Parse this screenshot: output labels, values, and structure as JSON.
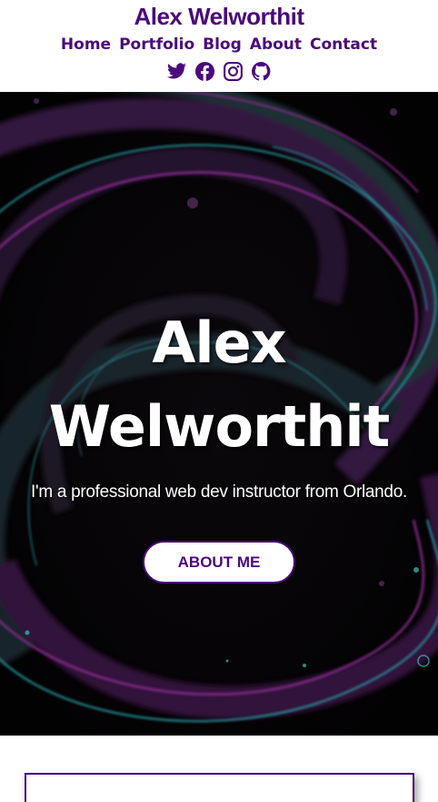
{
  "header": {
    "site_title": "Alex Welworthit",
    "nav": [
      {
        "label": "Home"
      },
      {
        "label": "Portfolio"
      },
      {
        "label": "Blog"
      },
      {
        "label": "About"
      },
      {
        "label": "Contact"
      }
    ],
    "social": [
      {
        "icon": "twitter-icon"
      },
      {
        "icon": "facebook-icon"
      },
      {
        "icon": "instagram-icon"
      },
      {
        "icon": "github-icon"
      }
    ]
  },
  "hero": {
    "name_line1": "Alex",
    "name_line2": "Welworthit",
    "tagline": "I'm a professional web dev instructor from Orlando.",
    "button_label": "ABOUT ME"
  },
  "colors": {
    "brand": "#4b0a7a",
    "hero_background": "#050405",
    "swirl_teal": "#2aa3a8",
    "swirl_purple": "#8a2a8f"
  }
}
